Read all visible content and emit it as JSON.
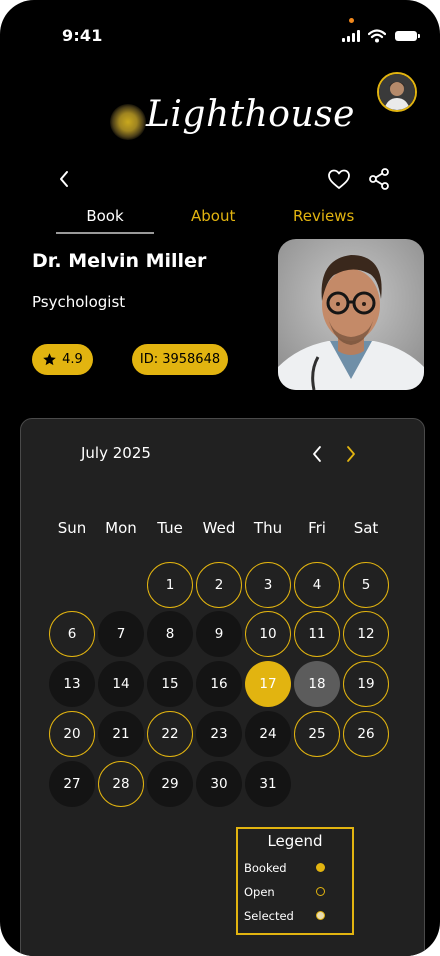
{
  "status_bar": {
    "time": "9:41"
  },
  "app": {
    "name": "Lighthouse"
  },
  "tabs": [
    {
      "label": "Book",
      "active": true
    },
    {
      "label": "About",
      "active": false
    },
    {
      "label": "Reviews",
      "active": false
    }
  ],
  "doctor": {
    "name": "Dr. Melvin Miller",
    "role": "Psychologist",
    "rating": "4.9",
    "id": "ID: 3958648"
  },
  "calendar": {
    "month": "July 2025",
    "weekdays": [
      "Sun",
      "Mon",
      "Tue",
      "Wed",
      "Thu",
      "Fri",
      "Sat"
    ],
    "first_weekday_index": 2,
    "days_in_month": 31,
    "open_days": [
      1,
      2,
      3,
      4,
      5,
      6,
      10,
      11,
      12,
      19,
      20,
      22,
      25,
      26,
      28
    ],
    "booked_days": [
      17
    ],
    "selected_days": [
      18
    ]
  },
  "legend": {
    "title": "Legend",
    "items": [
      {
        "label": "Booked",
        "style": "booked"
      },
      {
        "label": "Open",
        "style": "open"
      },
      {
        "label": "Selected",
        "style": "selected"
      }
    ]
  },
  "colors": {
    "accent": "#e2b410",
    "background": "#000000",
    "card": "#212121",
    "day_default": "#141414",
    "selected": "#5c5c5c"
  },
  "icons": [
    "back-icon",
    "heart-icon",
    "share-icon",
    "star-icon",
    "chevron-left-icon",
    "chevron-right-icon"
  ]
}
